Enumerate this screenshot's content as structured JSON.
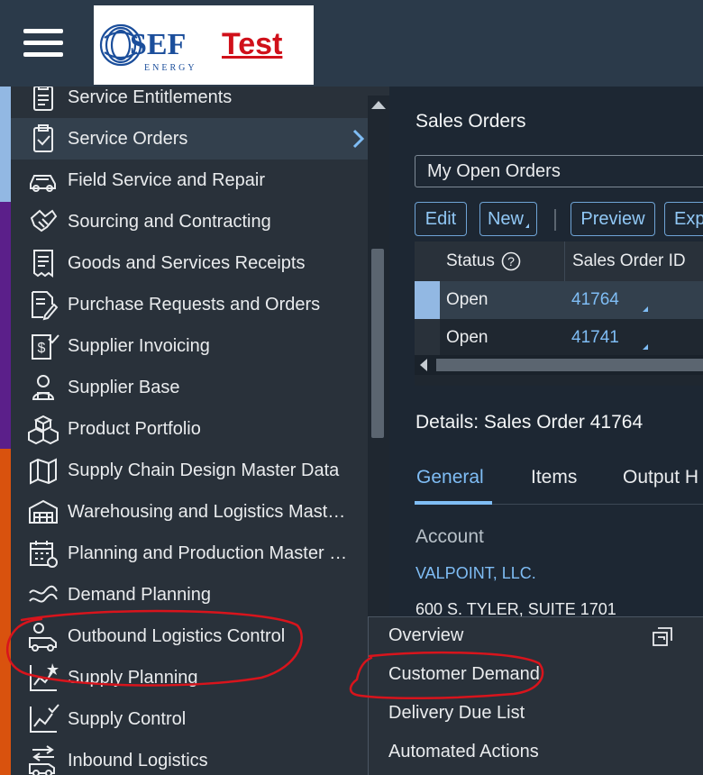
{
  "shell": {
    "logo_text": "SEF",
    "logo_subtext": "ENERGY",
    "env_label": "Test"
  },
  "sidenav": {
    "items": [
      {
        "label": "Service Entitlements",
        "icon": "clipboard-list-icon"
      },
      {
        "label": "Service Orders",
        "icon": "clipboard-check-icon",
        "selected": true
      },
      {
        "label": "Field Service and Repair",
        "icon": "car-icon"
      },
      {
        "label": "Sourcing and Contracting",
        "icon": "handshake-icon"
      },
      {
        "label": "Goods and Services Receipts",
        "icon": "receipt-icon"
      },
      {
        "label": "Purchase Requests and Orders",
        "icon": "document-pen-icon"
      },
      {
        "label": "Supplier Invoicing",
        "icon": "dollar-invoice-icon"
      },
      {
        "label": "Supplier Base",
        "icon": "supplier-person-icon"
      },
      {
        "label": "Product Portfolio",
        "icon": "boxes-icon"
      },
      {
        "label": "Supply Chain Design Master Data",
        "icon": "globe-map-icon"
      },
      {
        "label": "Warehousing and Logistics Mast…",
        "icon": "warehouse-icon"
      },
      {
        "label": "Planning and Production Master …",
        "icon": "calendar-gear-icon"
      },
      {
        "label": "Demand Planning",
        "icon": "wave-chart-icon"
      },
      {
        "label": "Outbound Logistics Control",
        "icon": "truck-person-icon"
      },
      {
        "label": "Supply Planning",
        "icon": "chart-star-icon"
      },
      {
        "label": "Supply Control",
        "icon": "chart-check-icon"
      },
      {
        "label": "Inbound Logistics",
        "icon": "truck-arrows-icon"
      }
    ]
  },
  "main": {
    "title": "Sales Orders",
    "query_select": "My Open Orders",
    "toolbar": {
      "edit": "Edit",
      "new": "New",
      "preview": "Preview",
      "export": "Exp"
    },
    "table": {
      "columns": [
        "Status",
        "Sales Order ID"
      ],
      "rows": [
        {
          "status": "Open",
          "id": "41764",
          "selected": true
        },
        {
          "status": "Open",
          "id": "41741",
          "selected": false
        }
      ]
    },
    "details_title": "Details: Sales Order 41764",
    "tabs": [
      "General",
      "Items",
      "Output H"
    ],
    "account_label": "Account",
    "account_name": "VALPOINT, LLC.",
    "account_address": "600 S. TYLER, SUITE 1701"
  },
  "popover": {
    "items": [
      "Overview",
      "Customer Demand",
      "Delivery Due List",
      "Automated Actions"
    ]
  },
  "colors": {
    "shell": "#2b3a4a",
    "nav_bg": "#29313a",
    "accent": "#7fbdf5",
    "annotation": "#d8141c",
    "strip_blue": "#92b8e3",
    "strip_purple": "#5b1f8a",
    "strip_orange": "#d9520e"
  }
}
